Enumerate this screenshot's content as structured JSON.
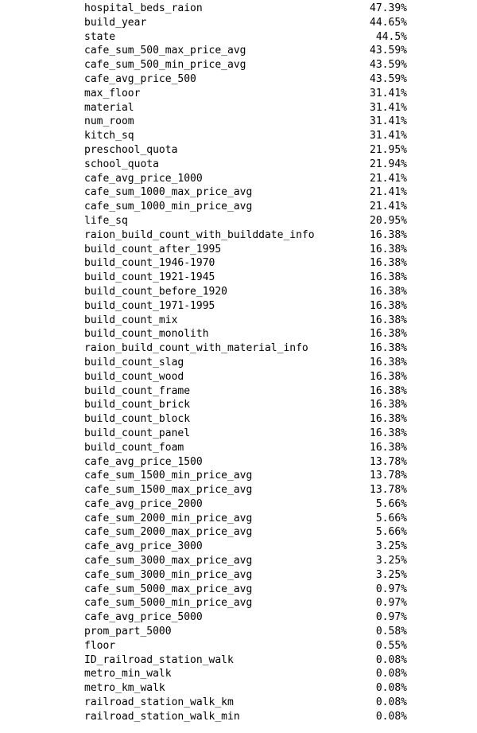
{
  "rows": [
    {
      "name": "hospital_beds_raion",
      "pct": "47.39%"
    },
    {
      "name": "build_year",
      "pct": "44.65%"
    },
    {
      "name": "state",
      "pct": "44.5%"
    },
    {
      "name": "cafe_sum_500_max_price_avg",
      "pct": "43.59%"
    },
    {
      "name": "cafe_sum_500_min_price_avg",
      "pct": "43.59%"
    },
    {
      "name": "cafe_avg_price_500",
      "pct": "43.59%"
    },
    {
      "name": "max_floor",
      "pct": "31.41%"
    },
    {
      "name": "material",
      "pct": "31.41%"
    },
    {
      "name": "num_room",
      "pct": "31.41%"
    },
    {
      "name": "kitch_sq",
      "pct": "31.41%"
    },
    {
      "name": "preschool_quota",
      "pct": "21.95%"
    },
    {
      "name": "school_quota",
      "pct": "21.94%"
    },
    {
      "name": "cafe_avg_price_1000",
      "pct": "21.41%"
    },
    {
      "name": "cafe_sum_1000_max_price_avg",
      "pct": "21.41%"
    },
    {
      "name": "cafe_sum_1000_min_price_avg",
      "pct": "21.41%"
    },
    {
      "name": "life_sq",
      "pct": "20.95%"
    },
    {
      "name": "raion_build_count_with_builddate_info",
      "pct": "16.38%"
    },
    {
      "name": "build_count_after_1995",
      "pct": "16.38%"
    },
    {
      "name": "build_count_1946-1970",
      "pct": "16.38%"
    },
    {
      "name": "build_count_1921-1945",
      "pct": "16.38%"
    },
    {
      "name": "build_count_before_1920",
      "pct": "16.38%"
    },
    {
      "name": "build_count_1971-1995",
      "pct": "16.38%"
    },
    {
      "name": "build_count_mix",
      "pct": "16.38%"
    },
    {
      "name": "build_count_monolith",
      "pct": "16.38%"
    },
    {
      "name": "raion_build_count_with_material_info",
      "pct": "16.38%"
    },
    {
      "name": "build_count_slag",
      "pct": "16.38%"
    },
    {
      "name": "build_count_wood",
      "pct": "16.38%"
    },
    {
      "name": "build_count_frame",
      "pct": "16.38%"
    },
    {
      "name": "build_count_brick",
      "pct": "16.38%"
    },
    {
      "name": "build_count_block",
      "pct": "16.38%"
    },
    {
      "name": "build_count_panel",
      "pct": "16.38%"
    },
    {
      "name": "build_count_foam",
      "pct": "16.38%"
    },
    {
      "name": "cafe_avg_price_1500",
      "pct": "13.78%"
    },
    {
      "name": "cafe_sum_1500_min_price_avg",
      "pct": "13.78%"
    },
    {
      "name": "cafe_sum_1500_max_price_avg",
      "pct": "13.78%"
    },
    {
      "name": "cafe_avg_price_2000",
      "pct": "5.66%"
    },
    {
      "name": "cafe_sum_2000_min_price_avg",
      "pct": "5.66%"
    },
    {
      "name": "cafe_sum_2000_max_price_avg",
      "pct": "5.66%"
    },
    {
      "name": "cafe_avg_price_3000",
      "pct": "3.25%"
    },
    {
      "name": "cafe_sum_3000_max_price_avg",
      "pct": "3.25%"
    },
    {
      "name": "cafe_sum_3000_min_price_avg",
      "pct": "3.25%"
    },
    {
      "name": "cafe_sum_5000_max_price_avg",
      "pct": "0.97%"
    },
    {
      "name": "cafe_sum_5000_min_price_avg",
      "pct": "0.97%"
    },
    {
      "name": "cafe_avg_price_5000",
      "pct": "0.97%"
    },
    {
      "name": "prom_part_5000",
      "pct": "0.58%"
    },
    {
      "name": "floor",
      "pct": "0.55%"
    },
    {
      "name": "ID_railroad_station_walk",
      "pct": "0.08%"
    },
    {
      "name": "metro_min_walk",
      "pct": "0.08%"
    },
    {
      "name": "metro_km_walk",
      "pct": "0.08%"
    },
    {
      "name": "railroad_station_walk_km",
      "pct": "0.08%"
    },
    {
      "name": "railroad_station_walk_min",
      "pct": "0.08%"
    }
  ]
}
